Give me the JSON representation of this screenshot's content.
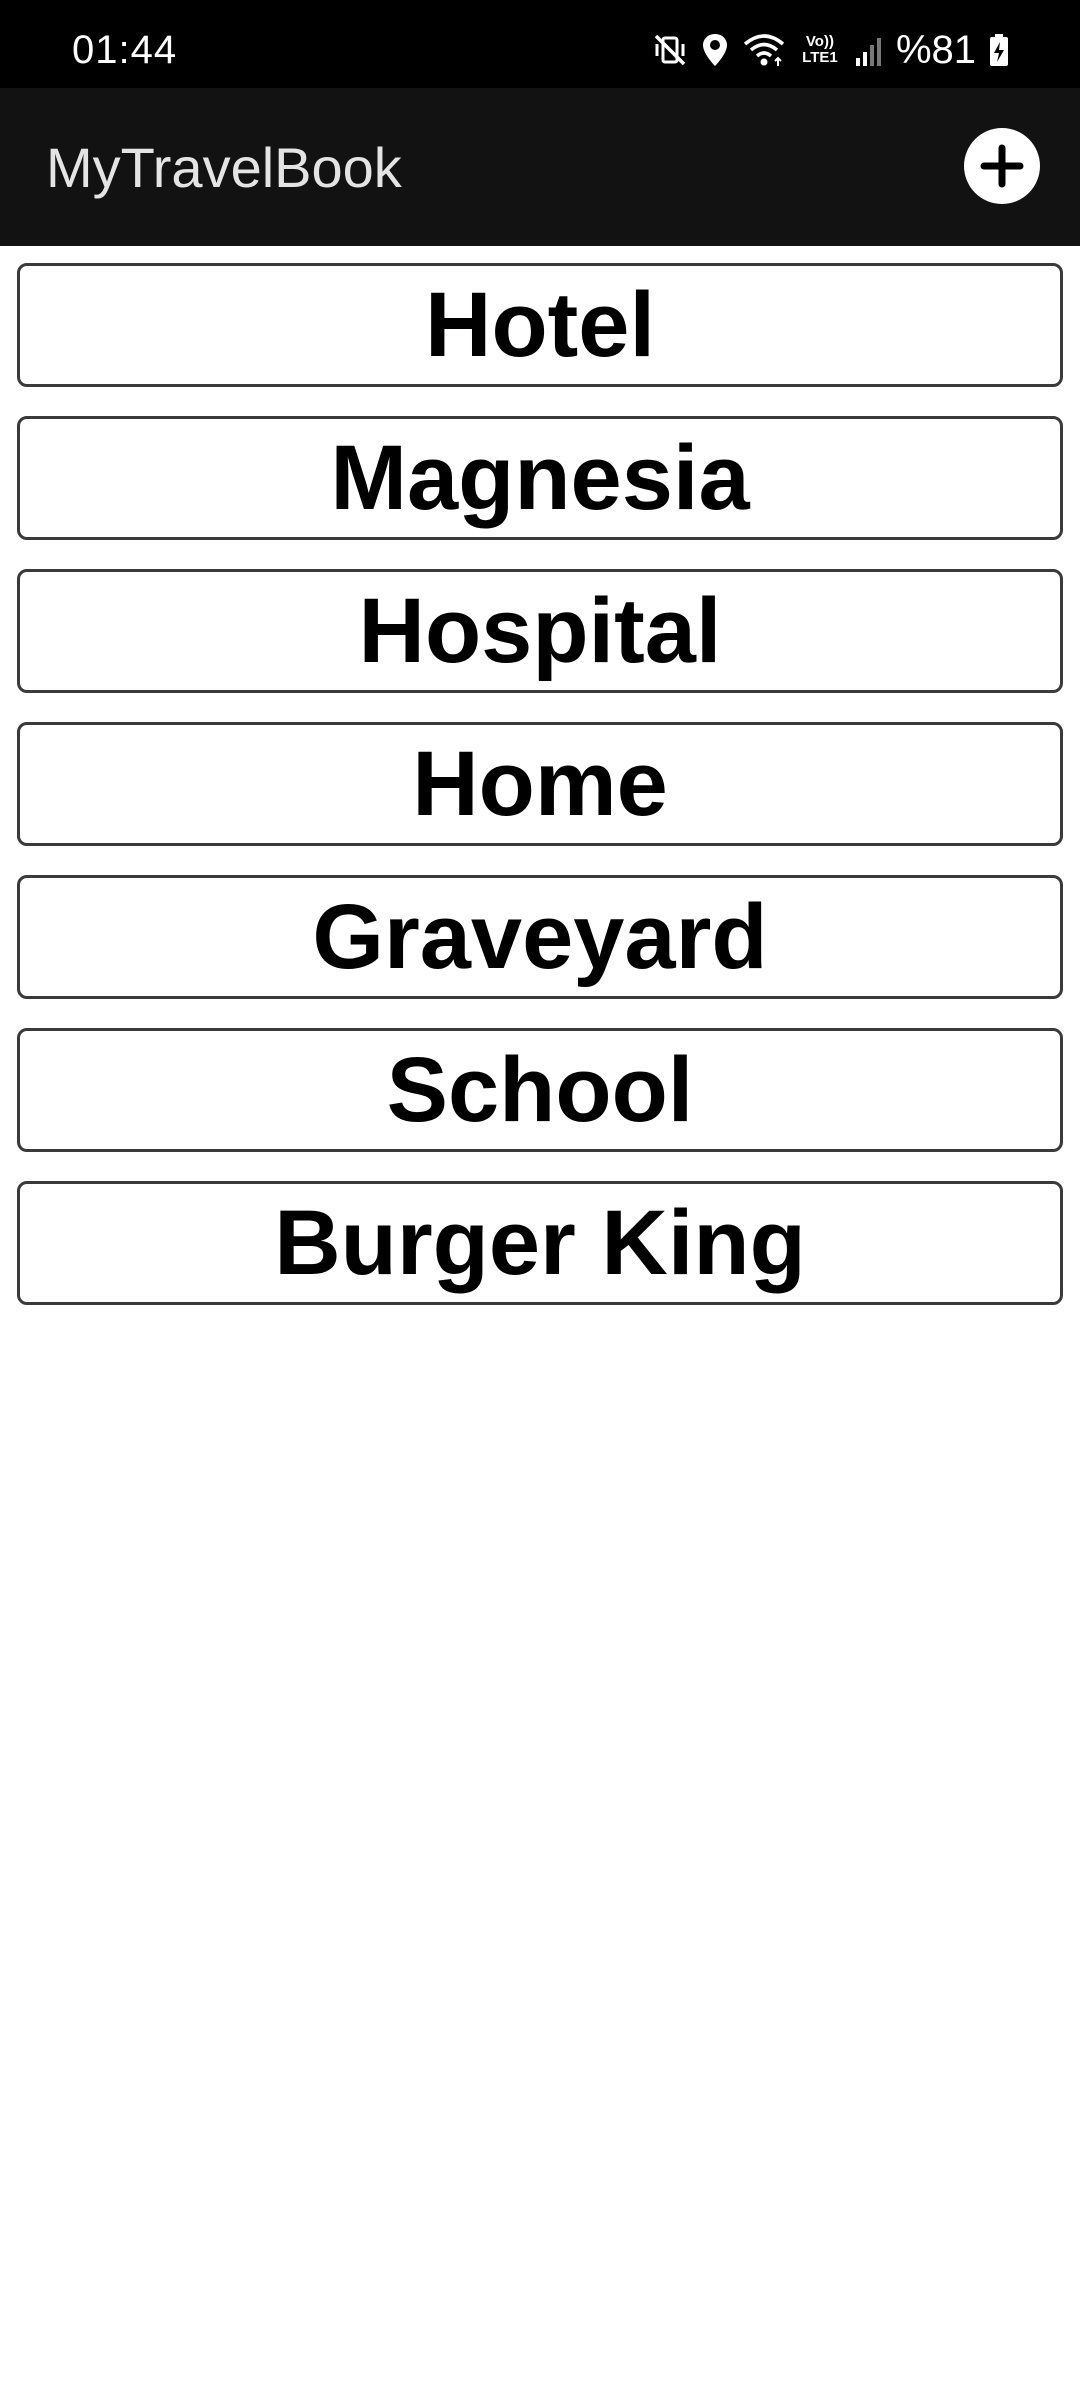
{
  "status_bar": {
    "time": "01:44",
    "network_label": "Vo)) LTE1",
    "battery": "%81",
    "icons": [
      "mute-vibrate-icon",
      "location-icon",
      "wifi-icon",
      "volte-icon",
      "signal-icon",
      "battery-charging-icon"
    ]
  },
  "app_bar": {
    "title": "MyTravelBook",
    "add_icon": "plus-icon"
  },
  "places": [
    {
      "label": "Hotel"
    },
    {
      "label": "Magnesia"
    },
    {
      "label": "Hospital"
    },
    {
      "label": "Home"
    },
    {
      "label": "Graveyard"
    },
    {
      "label": "School"
    },
    {
      "label": "Burger King"
    }
  ]
}
